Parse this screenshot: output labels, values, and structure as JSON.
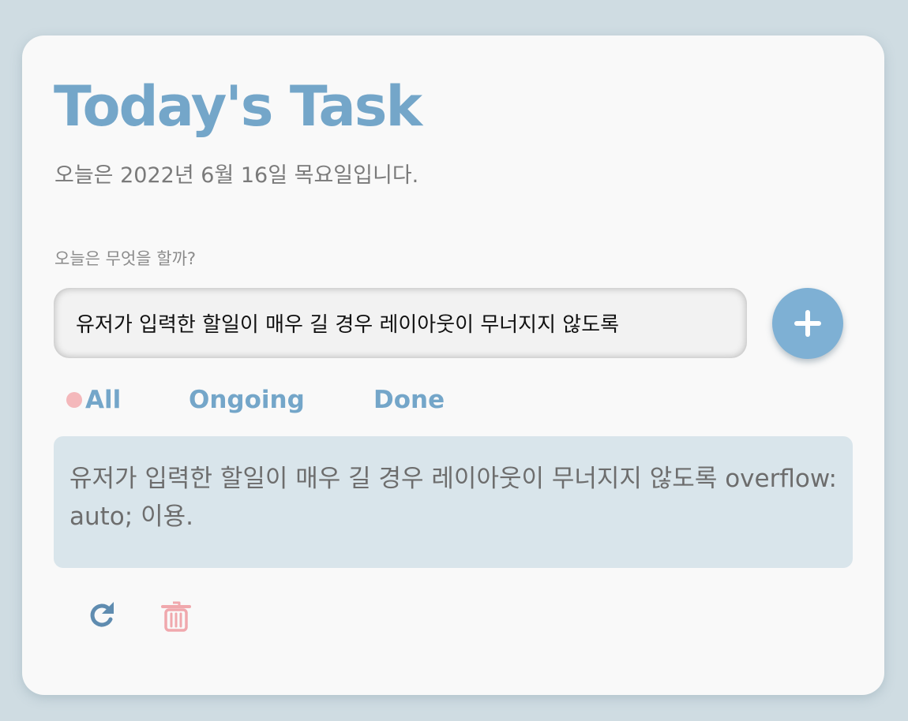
{
  "header": {
    "title": "Today's Task",
    "date_text": "오늘은 2022년 6월 16일 목요일입니다."
  },
  "input": {
    "label": "오늘은 무엇을 할까?",
    "value": "유저가 입력한 할일이 매우 길 경우 레이아웃이 무너지지 않도록",
    "add_icon": "plus-icon"
  },
  "tabs": [
    {
      "label": "All",
      "active": true
    },
    {
      "label": "Ongoing",
      "active": false
    },
    {
      "label": "Done",
      "active": false
    }
  ],
  "tasks": [
    {
      "text": "유저가 입력한 할일이 매우 길 경우 레이아웃이 무너지지 않도록 overflow:auto; 이용.",
      "actions": [
        "redo-icon",
        "trash-icon"
      ]
    }
  ],
  "colors": {
    "background": "#cfdce2",
    "card": "#f9f9f9",
    "accent": "#74a6c9",
    "add_button": "#7eb0d4",
    "active_dot": "#f4b8bb",
    "task_background": "#d9e5eb",
    "delete": "#f0a8ad"
  }
}
